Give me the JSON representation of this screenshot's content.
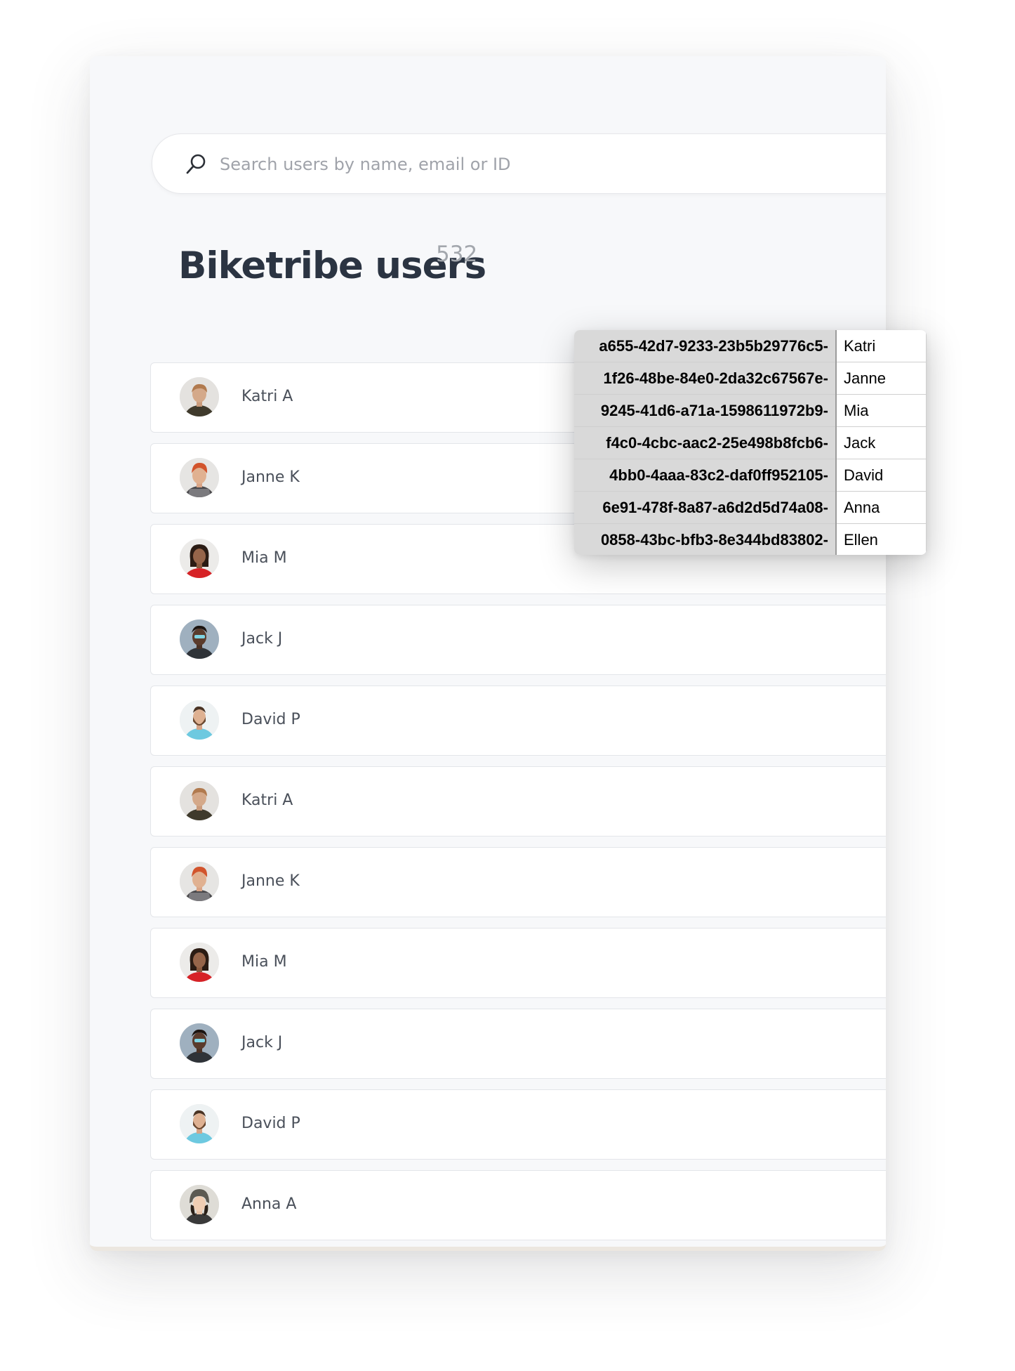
{
  "search": {
    "placeholder": "Search users by name, email or ID",
    "icon": "search-icon"
  },
  "header": {
    "title": "Biketribe users",
    "count": "532"
  },
  "users": [
    {
      "name": "Katri A",
      "avatar": "avatar-katri"
    },
    {
      "name": "Janne K",
      "avatar": "avatar-janne"
    },
    {
      "name": "Mia M",
      "avatar": "avatar-mia"
    },
    {
      "name": "Jack J",
      "avatar": "avatar-jack"
    },
    {
      "name": "David P",
      "avatar": "avatar-david"
    },
    {
      "name": "Katri A",
      "avatar": "avatar-katri"
    },
    {
      "name": "Janne K",
      "avatar": "avatar-janne"
    },
    {
      "name": "Mia M",
      "avatar": "avatar-mia"
    },
    {
      "name": "Jack J",
      "avatar": "avatar-jack"
    },
    {
      "name": "David P",
      "avatar": "avatar-david"
    },
    {
      "name": "Anna A",
      "avatar": "avatar-anna"
    }
  ],
  "overlay_table": [
    {
      "id": "-a655-42d7-9233-23b5b29776c5",
      "name": "Katri"
    },
    {
      "id": "-1f26-48be-84e0-2da32c67567e",
      "name": "Janne"
    },
    {
      "id": "-9245-41d6-a71a-1598611972b9",
      "name": "Mia"
    },
    {
      "id": "-f4c0-4cbc-aac2-25e498b8fcb6",
      "name": "Jack"
    },
    {
      "id": "-4bb0-4aaa-83c2-daf0ff952105",
      "name": "David"
    },
    {
      "id": "-6e91-478f-8a87-a6d2d5d74a08",
      "name": "Anna"
    },
    {
      "id": "-0858-43bc-bfb3-8e344bd83802",
      "name": "Ellen"
    }
  ],
  "colors": {
    "title": "#2b3442",
    "count": "#a3a7ad",
    "panel_bg": "#f7f8fa",
    "id_cell_bg": "#d9d9d9"
  }
}
